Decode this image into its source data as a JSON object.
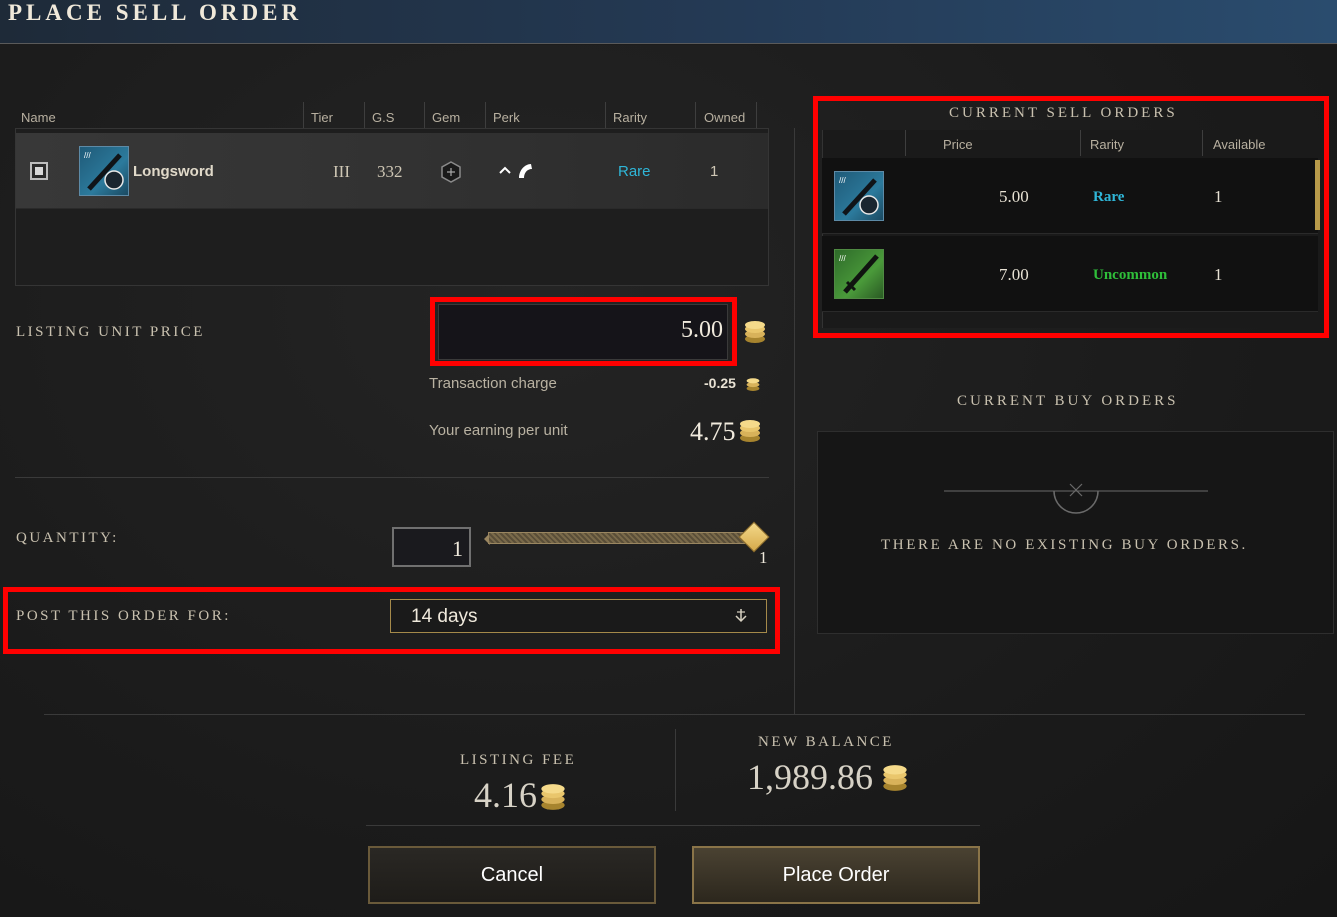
{
  "header": {
    "title": "PLACE SELL ORDER"
  },
  "item_table": {
    "columns": [
      "Name",
      "Tier",
      "G.S",
      "Gem",
      "Perk",
      "Rarity",
      "Owned"
    ],
    "row": {
      "name": "Longsword",
      "tier": "III",
      "gear_score": "332",
      "gem": "empty-gem-socket",
      "perk": "perk-icons",
      "rarity": "Rare",
      "owned": "1"
    }
  },
  "listing": {
    "label": "LISTING UNIT PRICE",
    "price": "5.00",
    "transaction_label": "Transaction charge",
    "transaction_value": "-0.25",
    "earning_label": "Your earning per unit",
    "earning_value": "4.75"
  },
  "quantity": {
    "label": "QUANTITY:",
    "value": "1",
    "slider_max_label": "1",
    "slider_fraction": 1.0
  },
  "duration": {
    "label": "POST THIS ORDER FOR:",
    "selected": "14 days"
  },
  "sell_orders": {
    "title": "CURRENT SELL ORDERS",
    "columns": [
      "Price",
      "Rarity",
      "Available"
    ],
    "rows": [
      {
        "price": "5.00",
        "rarity": "Rare",
        "available": "1",
        "rarity_color": "#2fb6d8"
      },
      {
        "price": "7.00",
        "rarity": "Uncommon",
        "available": "1",
        "rarity_color": "#2fbf3a"
      }
    ]
  },
  "buy_orders": {
    "title": "CURRENT BUY ORDERS",
    "empty_message": "THERE ARE NO EXISTING BUY ORDERS."
  },
  "footer": {
    "listing_fee_label": "LISTING FEE",
    "listing_fee": "4.16",
    "new_balance_label": "NEW BALANCE",
    "new_balance": "1,989.86"
  },
  "buttons": {
    "cancel": "Cancel",
    "place": "Place Order"
  },
  "colors": {
    "rare": "#2fb6d8",
    "uncommon": "#2fbf3a",
    "highlight": "#ff0000",
    "gold": "#d8b25a"
  }
}
